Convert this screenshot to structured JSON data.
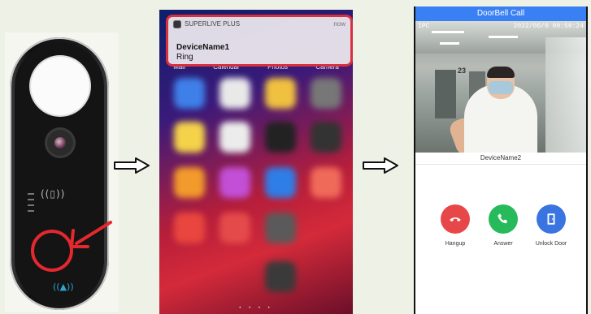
{
  "panel_notification": {
    "app_name": "SUPERLIVE PLUS",
    "time": "now",
    "title": "DeviceName1",
    "body": "Ring"
  },
  "home_screen": {
    "dock_labels": [
      "Mail",
      "Calendar",
      "Photos",
      "Camera"
    ],
    "page_dots": "• • • •"
  },
  "call_screen": {
    "header_title": "DoorBell Call",
    "osd_channel": "IPC",
    "osd_timestamp": "2022/06/0 09:59:24",
    "osd_sign": "23",
    "device_name": "DeviceName2",
    "buttons": [
      {
        "label": "Hangup",
        "color": "#e8474a"
      },
      {
        "label": "Answer",
        "color": "#27ba5a"
      },
      {
        "label": "Unlock Door",
        "color": "#3a74e0"
      }
    ]
  },
  "colors": {
    "highlight_red": "#e3282e",
    "header_blue": "#3a80f5",
    "background": "#eef2e6"
  }
}
